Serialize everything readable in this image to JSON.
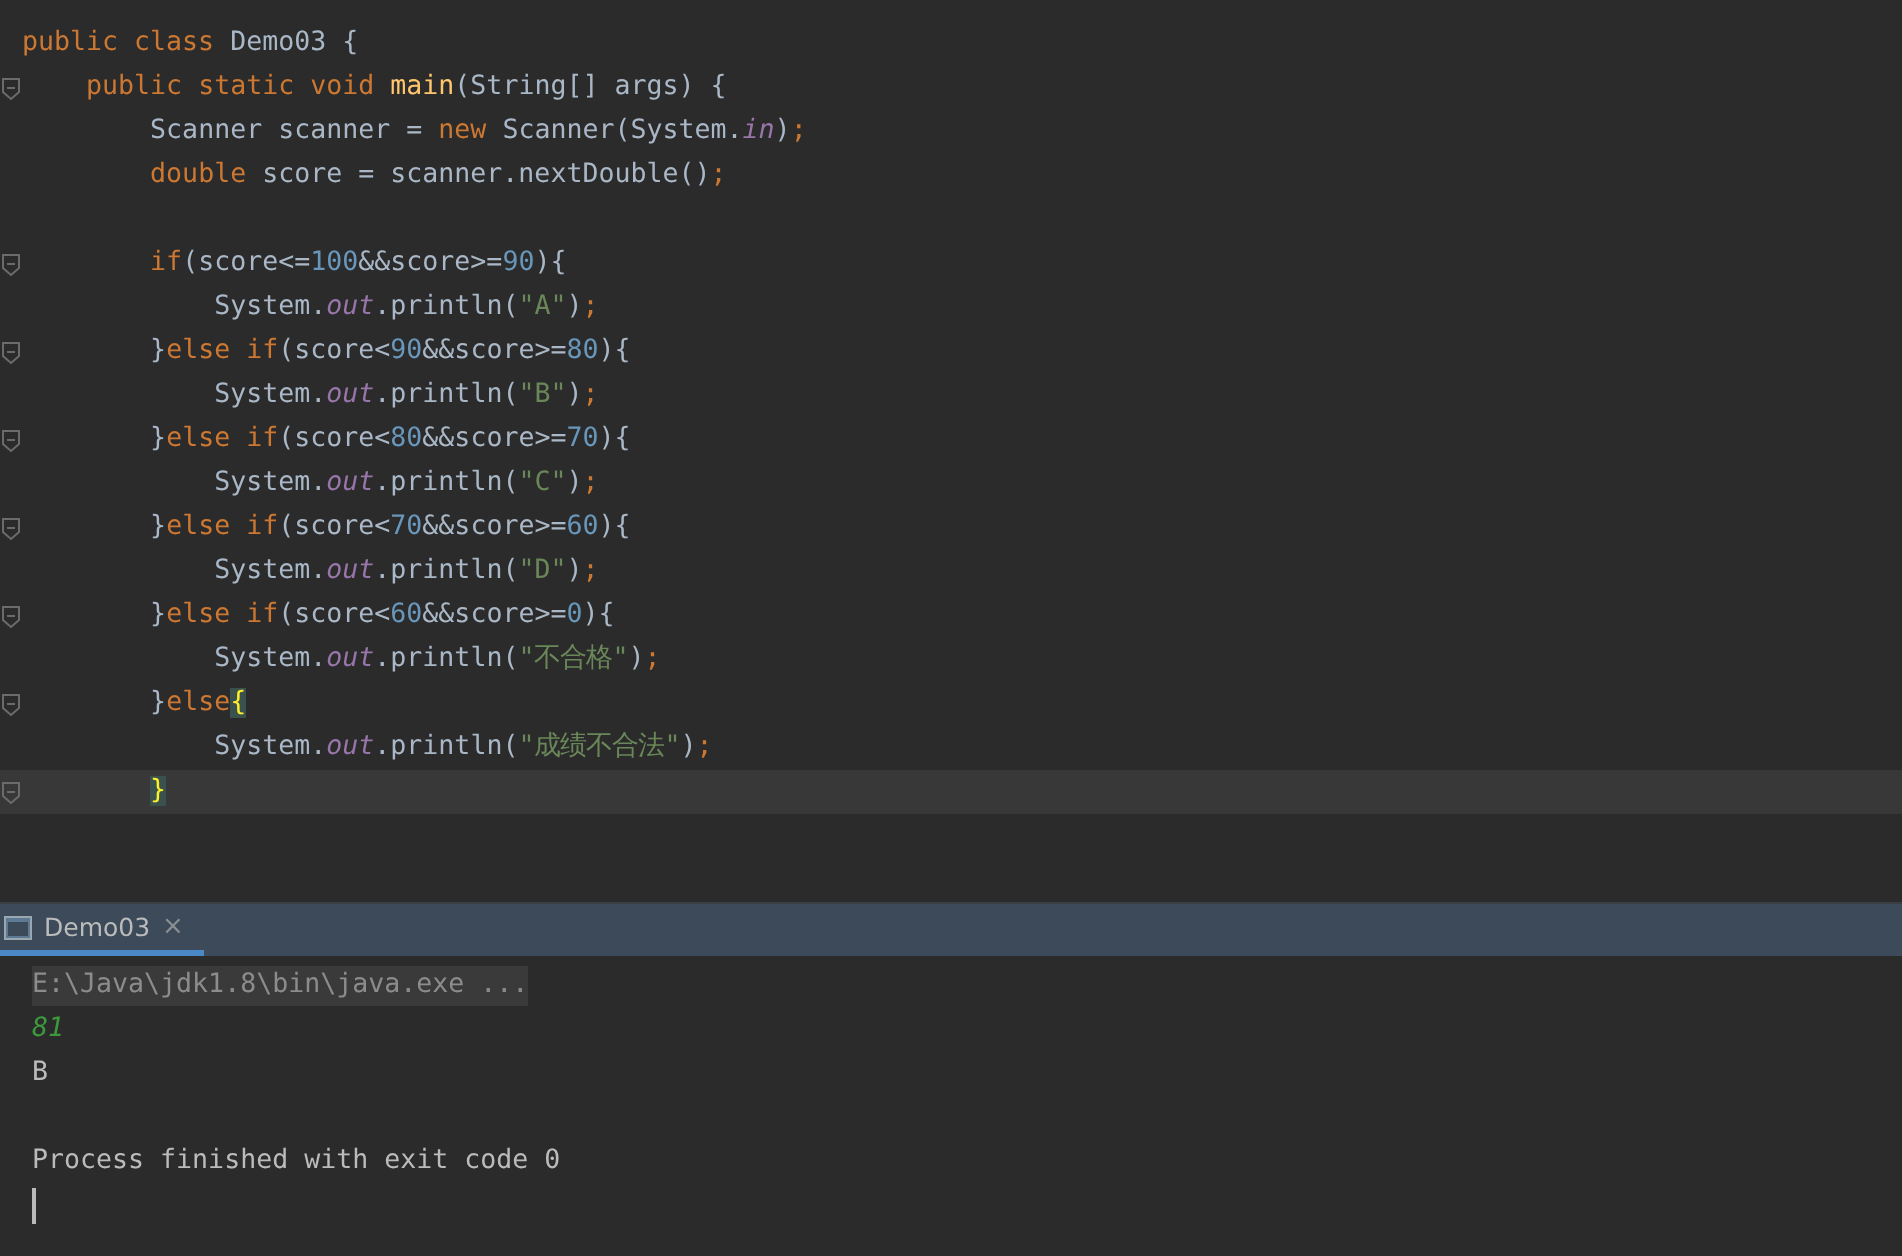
{
  "editor": {
    "lines": [
      {
        "fold": false,
        "current": false,
        "tokens": [
          {
            "kind": "kw",
            "text": "public class "
          },
          {
            "kind": "plain",
            "text": "Demo03 {"
          }
        ]
      },
      {
        "fold": true,
        "current": false,
        "tokens": [
          {
            "kind": "kw",
            "text": "    public static void "
          },
          {
            "kind": "method",
            "text": "main"
          },
          {
            "kind": "plain",
            "text": "(String[] args) {"
          }
        ]
      },
      {
        "fold": false,
        "current": false,
        "tokens": [
          {
            "kind": "plain",
            "text": "        Scanner scanner = "
          },
          {
            "kind": "kw",
            "text": "new "
          },
          {
            "kind": "plain",
            "text": "Scanner(System."
          },
          {
            "kind": "field",
            "text": "in"
          },
          {
            "kind": "plain",
            "text": ")"
          },
          {
            "kind": "kw",
            "text": ";"
          }
        ]
      },
      {
        "fold": false,
        "current": false,
        "tokens": [
          {
            "kind": "kw",
            "text": "        double "
          },
          {
            "kind": "plain",
            "text": "score = scanner.nextDouble()"
          },
          {
            "kind": "kw",
            "text": ";"
          }
        ]
      },
      {
        "fold": false,
        "current": false
      },
      {
        "fold": true,
        "current": false,
        "tokens": [
          {
            "kind": "kw",
            "text": "        if"
          },
          {
            "kind": "plain",
            "text": "(score<="
          },
          {
            "kind": "num",
            "text": "100"
          },
          {
            "kind": "plain",
            "text": "&&score>="
          },
          {
            "kind": "num",
            "text": "90"
          },
          {
            "kind": "plain",
            "text": "){"
          }
        ]
      },
      {
        "fold": false,
        "current": false,
        "tokens": [
          {
            "kind": "plain",
            "text": "            System."
          },
          {
            "kind": "field",
            "text": "out"
          },
          {
            "kind": "plain",
            "text": ".println("
          },
          {
            "kind": "str",
            "text": "\"A\""
          },
          {
            "kind": "plain",
            "text": ")"
          },
          {
            "kind": "kw",
            "text": ";"
          }
        ]
      },
      {
        "fold": true,
        "current": false,
        "tokens": [
          {
            "kind": "plain",
            "text": "        }"
          },
          {
            "kind": "kw",
            "text": "else if"
          },
          {
            "kind": "plain",
            "text": "(score<"
          },
          {
            "kind": "num",
            "text": "90"
          },
          {
            "kind": "plain",
            "text": "&&score>="
          },
          {
            "kind": "num",
            "text": "80"
          },
          {
            "kind": "plain",
            "text": "){"
          }
        ]
      },
      {
        "fold": false,
        "current": false,
        "tokens": [
          {
            "kind": "plain",
            "text": "            System."
          },
          {
            "kind": "field",
            "text": "out"
          },
          {
            "kind": "plain",
            "text": ".println("
          },
          {
            "kind": "str",
            "text": "\"B\""
          },
          {
            "kind": "plain",
            "text": ")"
          },
          {
            "kind": "kw",
            "text": ";"
          }
        ]
      },
      {
        "fold": true,
        "current": false,
        "tokens": [
          {
            "kind": "plain",
            "text": "        }"
          },
          {
            "kind": "kw",
            "text": "else if"
          },
          {
            "kind": "plain",
            "text": "(score<"
          },
          {
            "kind": "num",
            "text": "80"
          },
          {
            "kind": "plain",
            "text": "&&score>="
          },
          {
            "kind": "num",
            "text": "70"
          },
          {
            "kind": "plain",
            "text": "){"
          }
        ]
      },
      {
        "fold": false,
        "current": false,
        "tokens": [
          {
            "kind": "plain",
            "text": "            System."
          },
          {
            "kind": "field",
            "text": "out"
          },
          {
            "kind": "plain",
            "text": ".println("
          },
          {
            "kind": "str",
            "text": "\"C\""
          },
          {
            "kind": "plain",
            "text": ")"
          },
          {
            "kind": "kw",
            "text": ";"
          }
        ]
      },
      {
        "fold": true,
        "current": false,
        "tokens": [
          {
            "kind": "plain",
            "text": "        }"
          },
          {
            "kind": "kw",
            "text": "else if"
          },
          {
            "kind": "plain",
            "text": "(score<"
          },
          {
            "kind": "num",
            "text": "70"
          },
          {
            "kind": "plain",
            "text": "&&score>="
          },
          {
            "kind": "num",
            "text": "60"
          },
          {
            "kind": "plain",
            "text": "){"
          }
        ]
      },
      {
        "fold": false,
        "current": false,
        "tokens": [
          {
            "kind": "plain",
            "text": "            System."
          },
          {
            "kind": "field",
            "text": "out"
          },
          {
            "kind": "plain",
            "text": ".println("
          },
          {
            "kind": "str",
            "text": "\"D\""
          },
          {
            "kind": "plain",
            "text": ")"
          },
          {
            "kind": "kw",
            "text": ";"
          }
        ]
      },
      {
        "fold": true,
        "current": false,
        "tokens": [
          {
            "kind": "plain",
            "text": "        }"
          },
          {
            "kind": "kw",
            "text": "else if"
          },
          {
            "kind": "plain",
            "text": "(score<"
          },
          {
            "kind": "num",
            "text": "60"
          },
          {
            "kind": "plain",
            "text": "&&score>="
          },
          {
            "kind": "num",
            "text": "0"
          },
          {
            "kind": "plain",
            "text": "){"
          }
        ]
      },
      {
        "fold": false,
        "current": false,
        "tokens": [
          {
            "kind": "plain",
            "text": "            System."
          },
          {
            "kind": "field",
            "text": "out"
          },
          {
            "kind": "plain",
            "text": ".println("
          },
          {
            "kind": "str",
            "text": "\"不合格\""
          },
          {
            "kind": "plain",
            "text": ")"
          },
          {
            "kind": "kw",
            "text": ";"
          }
        ]
      },
      {
        "fold": true,
        "current": false,
        "tokens": [
          {
            "kind": "plain",
            "text": "        }"
          },
          {
            "kind": "kw",
            "text": "else"
          },
          {
            "kind": "match",
            "text": "{"
          }
        ]
      },
      {
        "fold": false,
        "current": false,
        "tokens": [
          {
            "kind": "plain",
            "text": "            System."
          },
          {
            "kind": "field",
            "text": "out"
          },
          {
            "kind": "plain",
            "text": ".println("
          },
          {
            "kind": "str",
            "text": "\"成绩不合法\""
          },
          {
            "kind": "plain",
            "text": ")"
          },
          {
            "kind": "kw",
            "text": ";"
          }
        ]
      },
      {
        "fold": true,
        "current": true,
        "tokens": [
          {
            "kind": "match",
            "text": "        }"
          }
        ]
      }
    ]
  },
  "run_panel": {
    "tabs": [
      {
        "label": "Demo03",
        "close": "×",
        "selected": true
      }
    ],
    "console": [
      {
        "kind": "command",
        "text": "E:\\Java\\jdk1.8\\bin\\java.exe ..."
      },
      {
        "kind": "input",
        "text": "81"
      },
      {
        "kind": "output",
        "text": "B"
      },
      {
        "kind": "blank"
      },
      {
        "kind": "output",
        "text": "Process finished with exit code 0"
      }
    ],
    "cursor": true
  }
}
